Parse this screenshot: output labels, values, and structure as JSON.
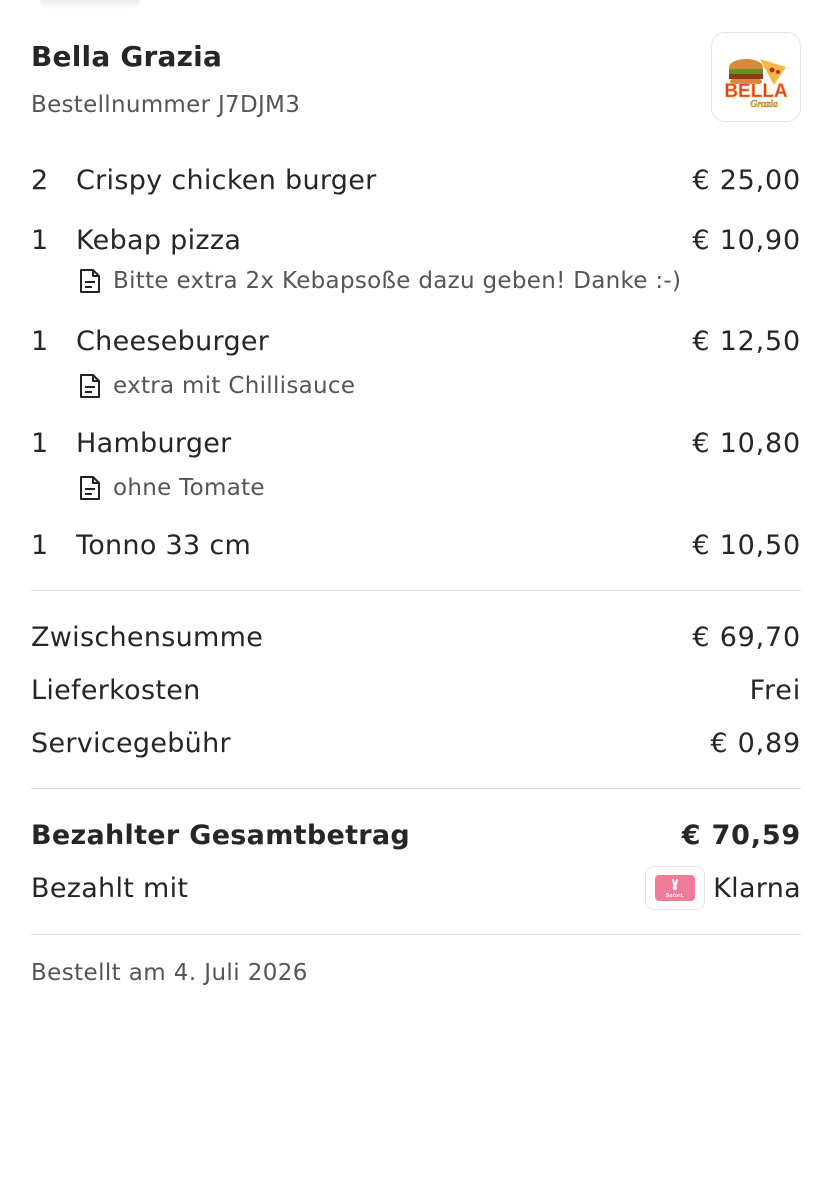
{
  "restaurant": {
    "name": "Bella Grazia",
    "order_number": "Bestellnummer J7DJM3",
    "logo_text_main": "BELLA",
    "logo_text_sub": "Grazia"
  },
  "items": [
    {
      "qty": "2",
      "name": "Crispy chicken burger",
      "price": "€ 25,00",
      "note": ""
    },
    {
      "qty": "1",
      "name": "Kebap pizza",
      "price": "€ 10,90",
      "note": "Bitte extra 2x Kebapsoße dazu geben! Danke :-)"
    },
    {
      "qty": "1",
      "name": "Cheeseburger",
      "price": "€ 12,50",
      "note": "extra mit Chillisauce"
    },
    {
      "qty": "1",
      "name": "Hamburger",
      "price": "€ 10,80",
      "note": "ohne Tomate"
    },
    {
      "qty": "1",
      "name": "Tonno 33 cm",
      "price": "€ 10,50",
      "note": ""
    }
  ],
  "summary": {
    "subtotal_label": "Zwischensumme",
    "subtotal_value": "€ 69,70",
    "delivery_label": "Lieferkosten",
    "delivery_value": "Frei",
    "service_label": "Servicegebühr",
    "service_value": "€ 0,89"
  },
  "total": {
    "label": "Bezahlter Gesamtbetrag",
    "value": "€ 70,59",
    "paid_with_label": "Bezahlt mit",
    "payment_method": "Klarna",
    "payment_icon_text": "Sofort."
  },
  "footer": {
    "ordered_at": "Bestellt am 4. Juli 2026"
  },
  "colors": {
    "text": "#262626",
    "secondary_text": "#555555",
    "divider": "#dcdcdc",
    "klarna_pink": "#ef7d9a",
    "logo_red": "#e53935",
    "logo_yellow": "#fbc02d"
  }
}
